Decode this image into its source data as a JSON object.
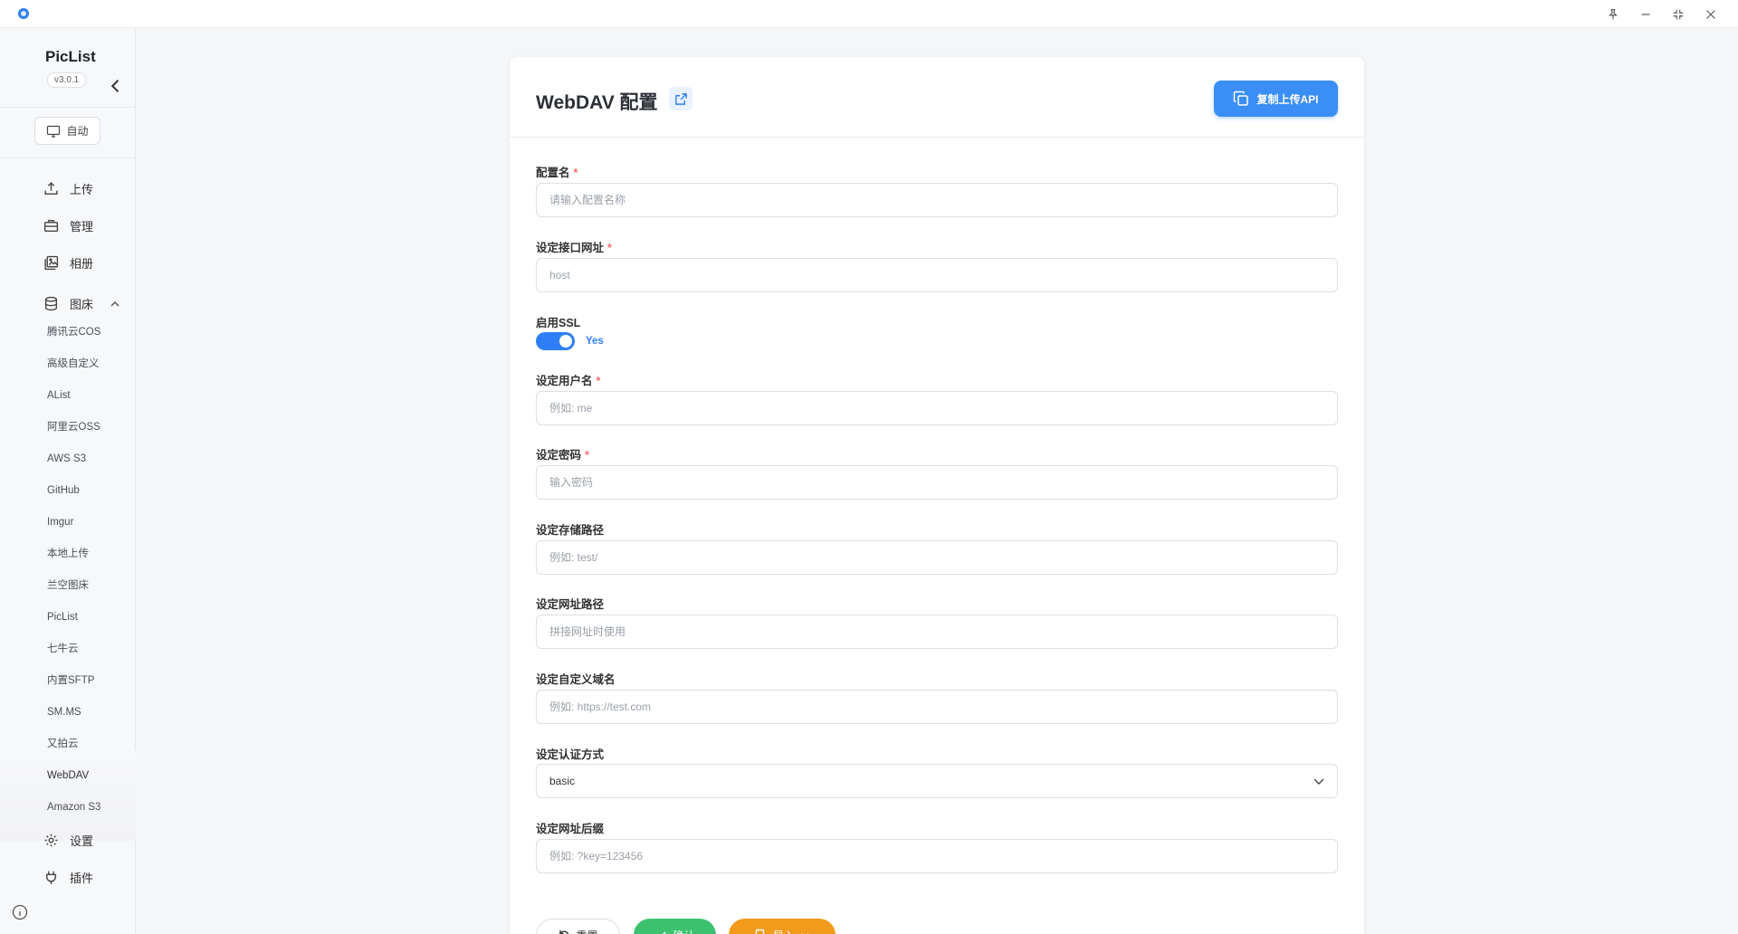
{
  "window": {
    "controls": [
      "pin-icon",
      "minimize-icon",
      "maximize-icon",
      "close-icon"
    ]
  },
  "sidebar": {
    "brand": "PicList",
    "version": "v3.0.1",
    "theme_label": "自动",
    "nav": {
      "upload": "上传",
      "manage": "管理",
      "gallery": "相册",
      "picbed": "图床",
      "settings": "设置",
      "plugins": "插件"
    },
    "picbeds": [
      "腾讯云COS",
      "高级自定义",
      "AList",
      "阿里云OSS",
      "AWS S3",
      "GitHub",
      "Imgur",
      "本地上传",
      "兰空图床",
      "PicList",
      "七牛云",
      "内置SFTP",
      "SM.MS",
      "又拍云",
      "WebDAV",
      "Amazon S3"
    ]
  },
  "form": {
    "title": "WebDAV 配置",
    "copy_api_label": "复制上传API",
    "required_mark": "*",
    "fields": {
      "config_name": {
        "label": "配置名",
        "placeholder": "请输入配置名称"
      },
      "host": {
        "label": "设定接口网址",
        "placeholder": "host"
      },
      "ssl": {
        "label": "启用SSL",
        "value": "Yes"
      },
      "username": {
        "label": "设定用户名",
        "placeholder": "例如: me"
      },
      "password": {
        "label": "设定密码",
        "placeholder": "输入密码"
      },
      "path": {
        "label": "设定存储路径",
        "placeholder": "例如: test/"
      },
      "web_path": {
        "label": "设定网址路径",
        "placeholder": "拼接网址时使用"
      },
      "custom_url": {
        "label": "设定自定义域名",
        "placeholder": "例如: https://test.com"
      },
      "auth_type": {
        "label": "设定认证方式",
        "value": "basic"
      },
      "options": {
        "label": "设定网址后缀",
        "placeholder": "例如: ?key=123456"
      }
    },
    "buttons": {
      "reset": "重置",
      "confirm": "确认",
      "import": "导入"
    }
  },
  "colors": {
    "primary": "#2f7ef5",
    "success": "#3cc26f",
    "warning": "#f39a1c",
    "required": "#f56c6c"
  }
}
